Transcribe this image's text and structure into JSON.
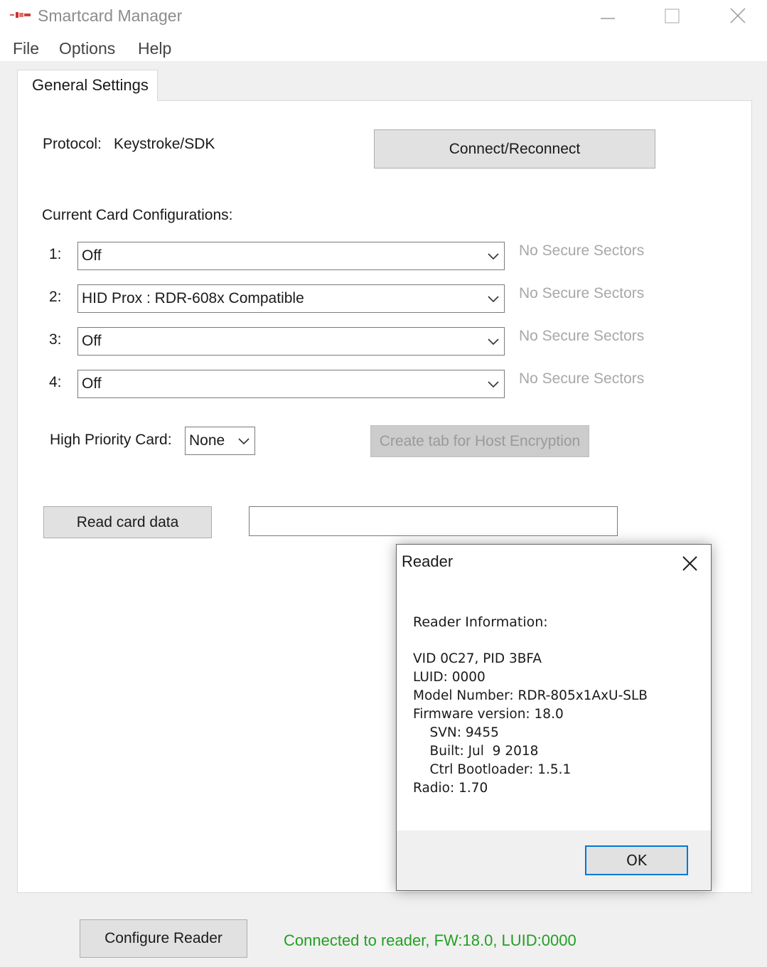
{
  "window": {
    "title": "Smartcard Manager",
    "icons": {
      "app": "app-logo-icon",
      "minimize": "minimize-icon",
      "maximize": "maximize-icon",
      "close": "close-icon"
    }
  },
  "menu": {
    "file": "File",
    "options": "Options",
    "help": "Help"
  },
  "tabs": {
    "general": "General Settings"
  },
  "general": {
    "protocol_label": "Protocol:",
    "protocol_value": "Keystroke/SDK",
    "connect_button": "Connect/Reconnect",
    "card_config_heading": "Current Card Configurations:",
    "slots": [
      {
        "num": "1:",
        "value": "Off",
        "secure": "No Secure Sectors"
      },
      {
        "num": "2:",
        "value": "HID Prox : RDR-608x Compatible",
        "secure": "No Secure Sectors"
      },
      {
        "num": "3:",
        "value": "Off",
        "secure": "No Secure Sectors"
      },
      {
        "num": "4:",
        "value": "Off",
        "secure": "No Secure Sectors"
      }
    ],
    "high_priority_label": "High Priority Card:",
    "high_priority_value": "None",
    "host_encryption_button": "Create tab for Host Encryption",
    "read_card_button": "Read card data",
    "card_data_value": ""
  },
  "footer": {
    "configure_button": "Configure Reader",
    "status": "Connected to reader, FW:18.0, LUID:0000",
    "status_color": "#22a022"
  },
  "dialog": {
    "title": "Reader",
    "heading": "Reader Information:",
    "lines": [
      "VID 0C27, PID 3BFA",
      "LUID: 0000",
      "Model Number: RDR-805x1AxU-SLB",
      "Firmware version: 18.0",
      "    SVN: 9455",
      "    Built: Jul  9 2018",
      "    Ctrl Bootloader: 1.5.1",
      "Radio: 1.70"
    ],
    "ok_button": "OK",
    "accent": "#0078d7"
  }
}
